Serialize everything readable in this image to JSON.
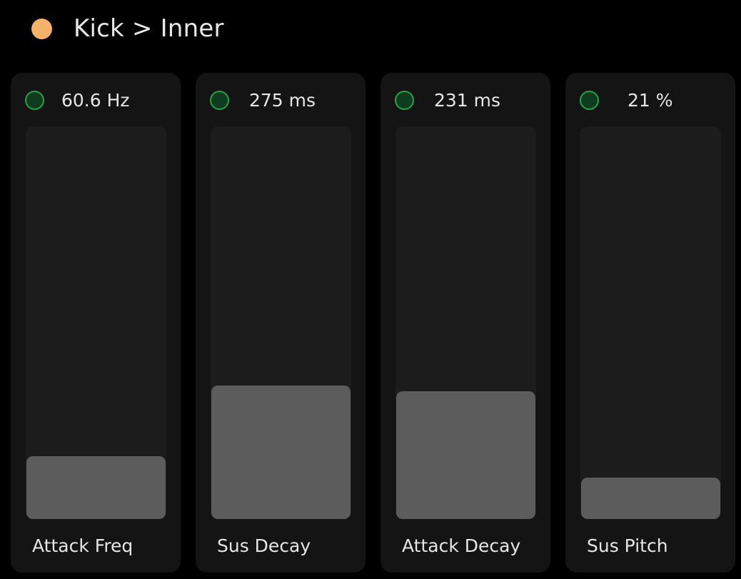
{
  "header": {
    "title": "Kick > Inner",
    "dot_color": "#f6b26b"
  },
  "sliders": [
    {
      "value": "60.6 Hz",
      "label": "Attack Freq",
      "level": 0.16,
      "led_color": "#23a24a"
    },
    {
      "value": "275 ms",
      "label": "Sus Decay",
      "level": 0.34,
      "led_color": "#23a24a"
    },
    {
      "value": "231 ms",
      "label": "Attack Decay",
      "level": 0.325,
      "led_color": "#23a24a"
    },
    {
      "value": "21 %",
      "label": "Sus Pitch",
      "level": 0.105,
      "led_color": "#23a24a"
    }
  ],
  "colors": {
    "background": "#000000",
    "panel": "#141414",
    "track": "#1c1c1c",
    "fill": "#5c5c5c",
    "text": "#e6e6e6"
  }
}
